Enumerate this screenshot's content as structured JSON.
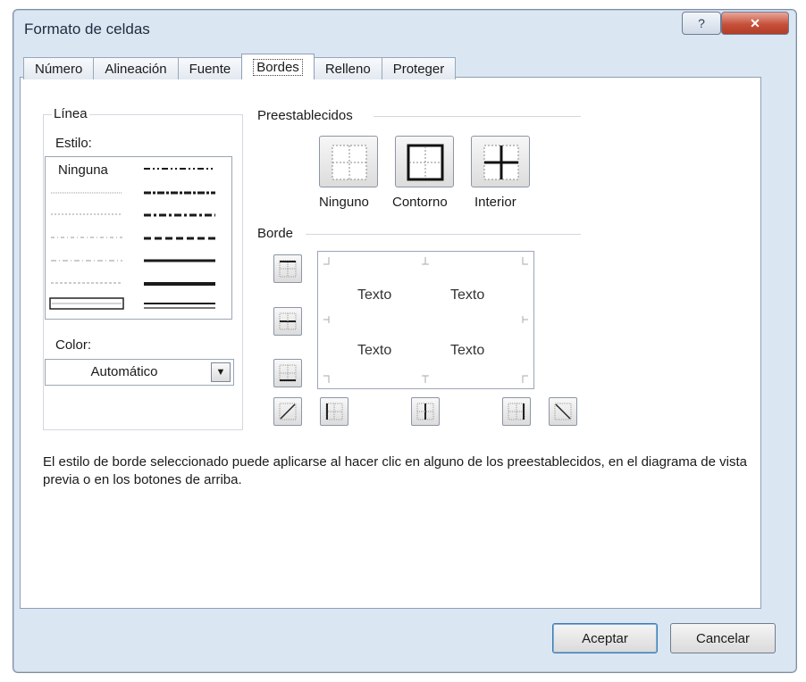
{
  "window": {
    "title": "Formato de celdas",
    "help": "?",
    "close": "✕"
  },
  "tabs": [
    "Número",
    "Alineación",
    "Fuente",
    "Bordes",
    "Relleno",
    "Proteger"
  ],
  "line_group": {
    "title": "Línea",
    "style_label": "Estilo:",
    "none_label": "Ninguna",
    "color_label": "Color:",
    "color_value": "Automático"
  },
  "presets": {
    "title": "Preestablecidos",
    "items": [
      "Ninguno",
      "Contorno",
      "Interior"
    ]
  },
  "border": {
    "title": "Borde",
    "preview_text": [
      "Texto",
      "Texto",
      "Texto",
      "Texto"
    ]
  },
  "description": "El estilo de borde seleccionado puede aplicarse al hacer clic en alguno de los preestablecidos, en el diagrama de vista previa o en los botones de arriba.",
  "buttons": {
    "ok": "Aceptar",
    "cancel": "Cancelar"
  }
}
